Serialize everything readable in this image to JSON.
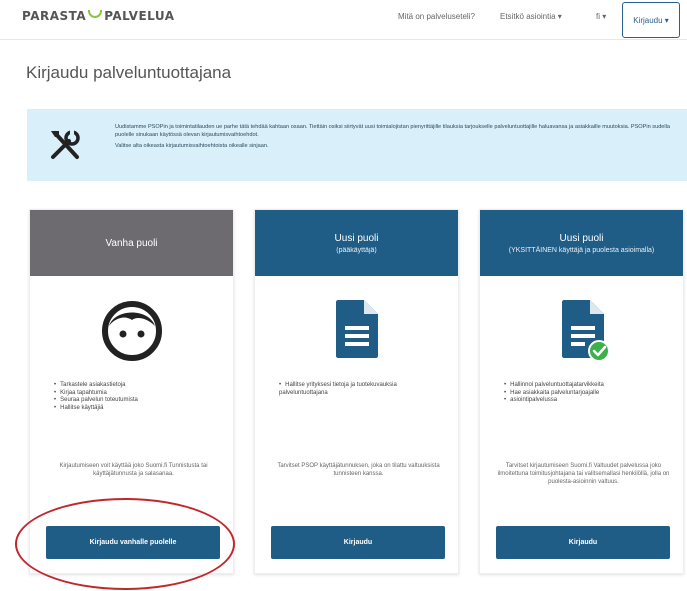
{
  "header": {
    "logo_left": "PARASTA",
    "logo_right": "PALVELUA",
    "nav": [
      {
        "label": "Mitä on palveluseteli?"
      },
      {
        "label": "Etsitkö asiointia ▾"
      },
      {
        "label": "fi ▾"
      }
    ],
    "login_label": "Kirjaudu ▾"
  },
  "page": {
    "title": "Kirjaudu palveluntuottajana"
  },
  "notice": {
    "icon": "tools-icon",
    "paragraph1": "Uudistamme PSOPin ja toimintatilauden ue parhe tätä tehdää kahtaan osaan. Tiettäin osiksi siirtyvät uusi toimialojistan pienyrittäjille tilauksia tarjoukselle palveluntuottajille haluavansa ja asiakkaille muutoksia. PSOPin sudella puolelle sinukaan käytössä olevan kirjautumisvaihtoehdot.",
    "paragraph2": "Valitse alta oikeasta kirjautumisvaihtoehtoista oikealle sinjaan."
  },
  "cards": [
    {
      "title": "Vanha puoli",
      "subtitle": "",
      "header_color": "#6d6b70",
      "icon": "face-icon",
      "items": [
        "Tarkastele asiakastietoja",
        "Kirjaa tapahtumia",
        "Seuraa palvelun toteutumista",
        "Hallitse käyttäjiä"
      ],
      "description": "Kirjautumiseen voit käyttää joko Suomi.fi Tunnistusta tai käyttäjätunnusta ja salasanaa.",
      "button": "Kirjaudu vanhalle puolelle"
    },
    {
      "title": "Uusi puoli",
      "subtitle": "(pääkäyttäjä)",
      "header_color": "#1f5c86",
      "icon": "document-icon",
      "items": [
        "Hallitse yrityksesi tietoja ja tuotekuvauksia palveluntuottajana"
      ],
      "description": "Tarvitset PSOP käyttäjätunnuksen, joka on tilattu valtuuksista tunnisteen kanssa.",
      "button": "Kirjaudu"
    },
    {
      "title": "Uusi puoli",
      "subtitle": "(YKSITTÄINEN käyttäjä ja puolesta asioimalla)",
      "header_color": "#1f5c86",
      "icon": "document-check-icon",
      "items": [
        "Hallinnoi palveluntuottajatarvikkeita",
        "Hae asiakkaita palveluntarjoajalle",
        "asiointipalvelussa"
      ],
      "description": "Tarvitset kirjautumiseen Suomi.fi Valtuudet palvelussa joko ilmoitettuna toimitusjohtajana tai valitsemallasi henkilöllä, jolla on puolesta-asioinnin valtuus.",
      "button": "Kirjaudu"
    }
  ],
  "colors": {
    "primary": "#1f5c86",
    "legacy_header": "#6d6b70",
    "notice_bg": "#d9effa",
    "logo_accent": "#8cc63f",
    "check_green": "#3cb14a",
    "annotation_red": "#c1272d"
  }
}
